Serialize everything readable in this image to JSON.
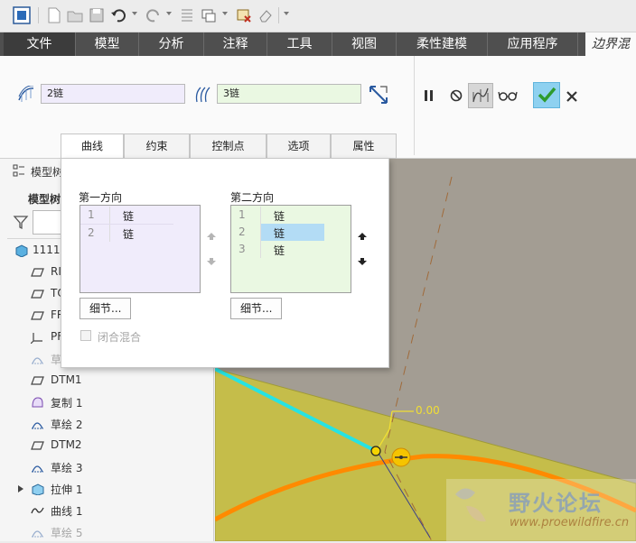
{
  "ribbon_tabs": {
    "file": "文件",
    "model": "模型",
    "analysis": "分析",
    "annotate": "注释",
    "tools": "工具",
    "view": "视图",
    "flexible": "柔性建模",
    "apps": "应用程序",
    "boundary": "边界混"
  },
  "ribbon": {
    "first_field": "2链",
    "second_field": "3链"
  },
  "dialog": {
    "tabs": {
      "curves": "曲线",
      "constraints": "约束",
      "control_points": "控制点",
      "options": "选项",
      "properties": "属性"
    },
    "first_direction": {
      "title": "第一方向",
      "rows": [
        {
          "num": "1",
          "name": "链"
        },
        {
          "num": "2",
          "name": "链"
        }
      ],
      "details": "细节..."
    },
    "second_direction": {
      "title": "第二方向",
      "rows": [
        {
          "num": "1",
          "name": "链"
        },
        {
          "num": "2",
          "name": "链"
        },
        {
          "num": "3",
          "name": "链"
        }
      ],
      "details": "细节..."
    },
    "closed_blend": "闭合混合"
  },
  "tree": {
    "header": "模型树",
    "subheader": "模型树",
    "items": [
      {
        "label": "1111.",
        "icon": "part-icon"
      },
      {
        "label": "RI",
        "icon": "datum-plane-icon"
      },
      {
        "label": "TO",
        "icon": "datum-plane-icon"
      },
      {
        "label": "FR",
        "icon": "datum-plane-icon"
      },
      {
        "label": "PF",
        "icon": "csys-icon"
      },
      {
        "label": "草",
        "icon": "sketch-icon"
      },
      {
        "label": "DTM1",
        "icon": "datum-plane-icon"
      },
      {
        "label": "复制 1",
        "icon": "copy-icon"
      },
      {
        "label": "草绘 2",
        "icon": "sketch-icon"
      },
      {
        "label": "DTM2",
        "icon": "datum-plane-icon"
      },
      {
        "label": "草绘 3",
        "icon": "sketch-icon"
      },
      {
        "label": "拉伸 1",
        "icon": "extrude-icon"
      },
      {
        "label": "曲线 1",
        "icon": "curve-icon"
      },
      {
        "label": "草绘 5",
        "icon": "sketch-icon"
      }
    ]
  },
  "viewport": {
    "dimension_label": "0.00",
    "watermark_title": "野火论坛",
    "watermark_url": "www.proewildfire.cn"
  },
  "colors": {
    "tab_bar": "#4f4f4f",
    "surface": "#c5bd4a",
    "orange_curve": "#ff8a00",
    "cyan_edge": "#26e3e3",
    "selected_row": "#b3dcf5",
    "ok_button": "#2e9b2e"
  }
}
